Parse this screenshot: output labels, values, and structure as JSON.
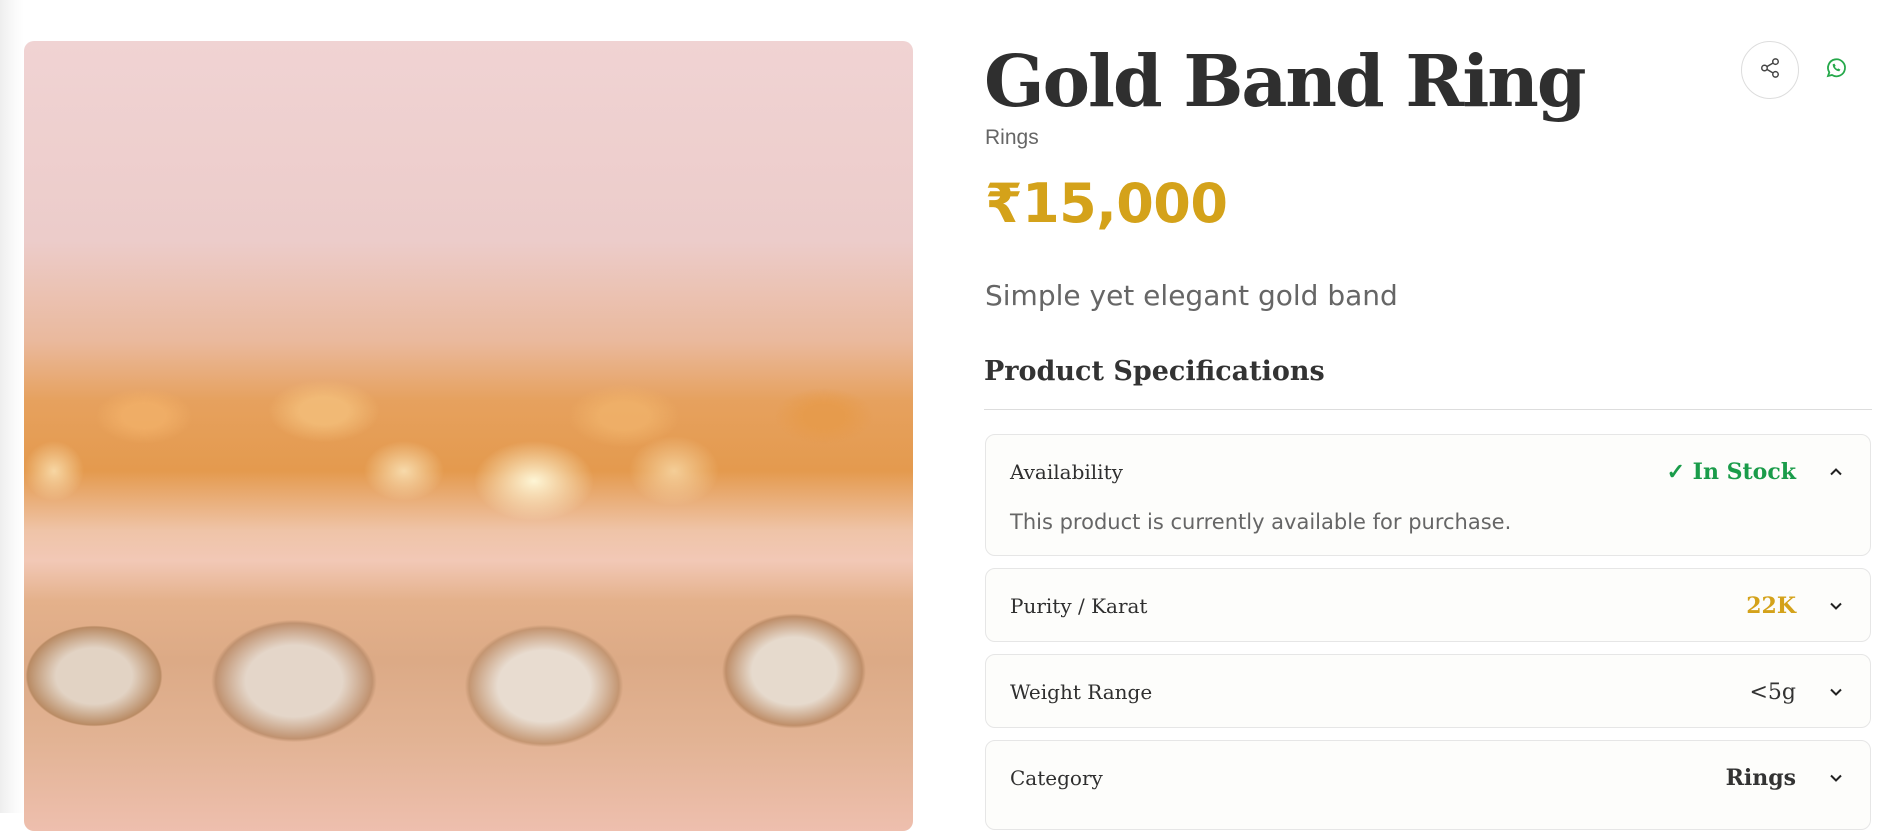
{
  "product": {
    "title": "Gold Band Ring",
    "category": "Rings",
    "price": "₹15,000",
    "description": "Simple yet elegant gold band"
  },
  "specs": {
    "heading": "Product Specifications",
    "items": [
      {
        "label": "Availability",
        "value": "✓ In Stock",
        "body": "This product is currently available for purchase.",
        "expanded": true,
        "value_color": "#1a9c4a"
      },
      {
        "label": "Purity / Karat",
        "value": "22K",
        "expanded": false,
        "value_color": "#d4a21a"
      },
      {
        "label": "Weight Range",
        "value": "<5g",
        "expanded": false,
        "value_color": "#333333"
      },
      {
        "label": "Category",
        "value": "Rings",
        "expanded": false,
        "value_color": "#333333"
      }
    ]
  },
  "actions": {
    "share_icon": "share-icon",
    "whatsapp_icon": "whatsapp-icon"
  },
  "colors": {
    "price": "#d4a21a",
    "in_stock": "#1a9c4a",
    "whatsapp": "#25a84a"
  }
}
